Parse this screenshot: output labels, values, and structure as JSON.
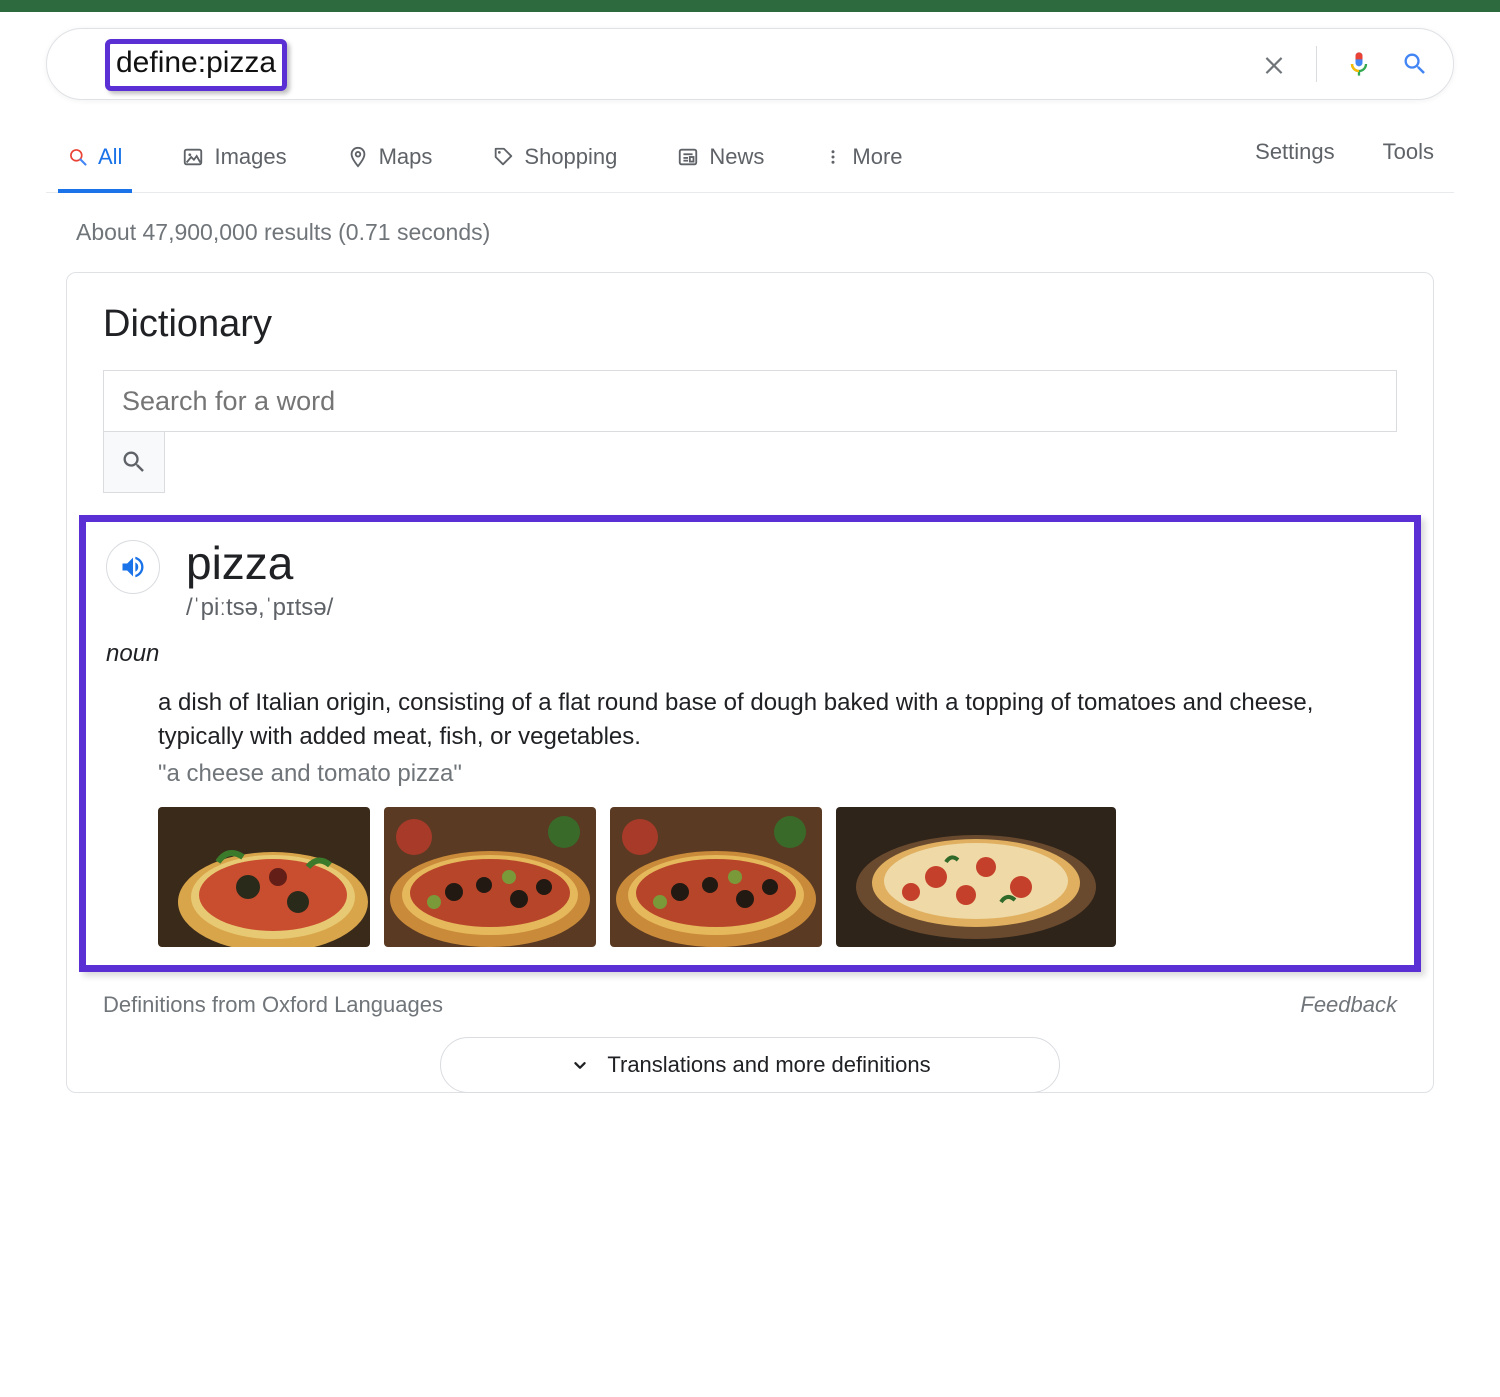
{
  "search": {
    "query": "define:pizza"
  },
  "tabs": {
    "all": "All",
    "images": "Images",
    "maps": "Maps",
    "shopping": "Shopping",
    "news": "News",
    "more": "More",
    "settings": "Settings",
    "tools": "Tools"
  },
  "stats": "About 47,900,000 results (0.71 seconds)",
  "dict": {
    "title": "Dictionary",
    "placeholder": "Search for a word",
    "word": "pizza",
    "pronunciation": "/ˈpiːtsə,ˈpɪtsə/",
    "pos": "noun",
    "definition": "a dish of Italian origin, consisting of a flat round base of dough baked with a topping of tomatoes and cheese, typically with added meat, fish, or vegetables.",
    "example": "\"a cheese and tomato pizza\"",
    "source": "Definitions from Oxford Languages",
    "feedback": "Feedback",
    "more": "Translations and more definitions"
  }
}
